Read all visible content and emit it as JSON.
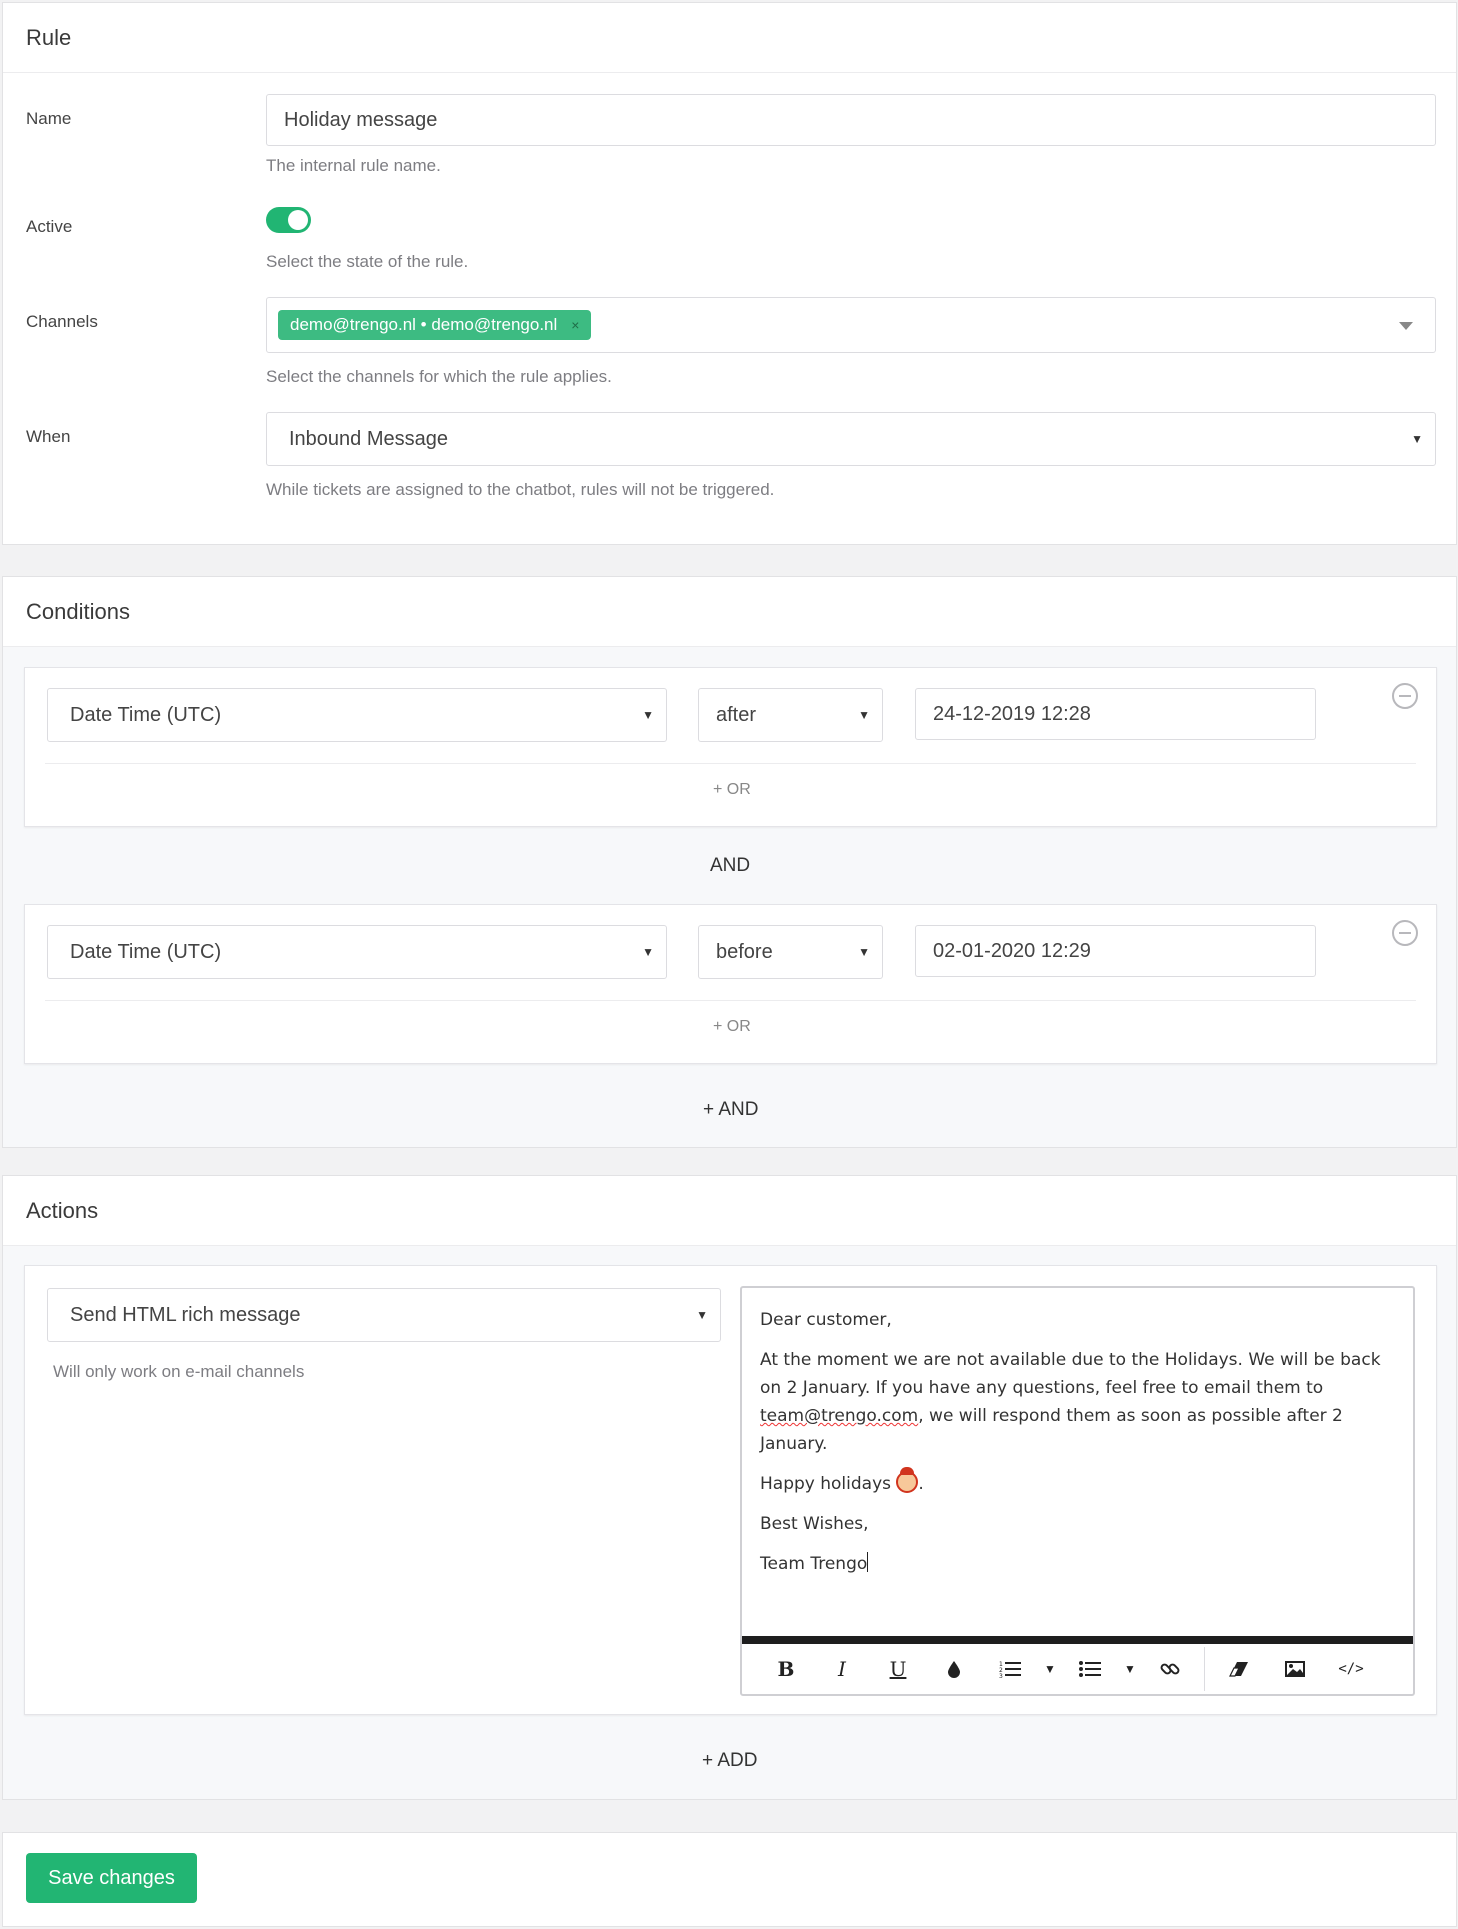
{
  "rule": {
    "title": "Rule",
    "name_label": "Name",
    "name_value": "Holiday message",
    "name_help": "The internal rule name.",
    "active_label": "Active",
    "active_on": true,
    "active_help": "Select the state of the rule.",
    "channels_label": "Channels",
    "channel_tag": "demo@trengo.nl • demo@trengo.nl",
    "channel_tag_remove": "×",
    "channels_help": "Select the channels for which the rule applies.",
    "when_label": "When",
    "when_value": "Inbound Message",
    "when_help": "While tickets are assigned to the chatbot, rules will not be triggered."
  },
  "conditions": {
    "title": "Conditions",
    "groups": [
      {
        "field": "Date Time (UTC)",
        "operator": "after",
        "value": "24-12-2019 12:28",
        "or_label": "+ OR"
      },
      {
        "field": "Date Time (UTC)",
        "operator": "before",
        "value": "02-01-2020 12:29",
        "or_label": "+ OR"
      }
    ],
    "and_separator": "AND",
    "add_and": "+ AND"
  },
  "actions": {
    "title": "Actions",
    "type": "Send HTML rich message",
    "type_help": "Will only work on e-mail channels",
    "message": {
      "greeting": "Dear customer,",
      "para1_start": "At the moment we are not available due to the Holidays. We will be back on 2 January. If you have any questions, feel free to email them to ",
      "email": "team@trengo.com",
      "para1_end": ", we will respond them as soon as possible after 2 January.",
      "holidays": "Happy holidays",
      "holidays_end": ".",
      "wishes": "Best Wishes,",
      "signature": "Team Trengo"
    },
    "toolbar": [
      "bold",
      "italic",
      "underline",
      "text-color",
      "ordered-list",
      "unordered-list",
      "link",
      "clear-format",
      "image",
      "code"
    ],
    "add_label": "+ ADD"
  },
  "save_label": "Save changes",
  "colors": {
    "accent": "#22b573",
    "tag": "#3dbb82"
  }
}
